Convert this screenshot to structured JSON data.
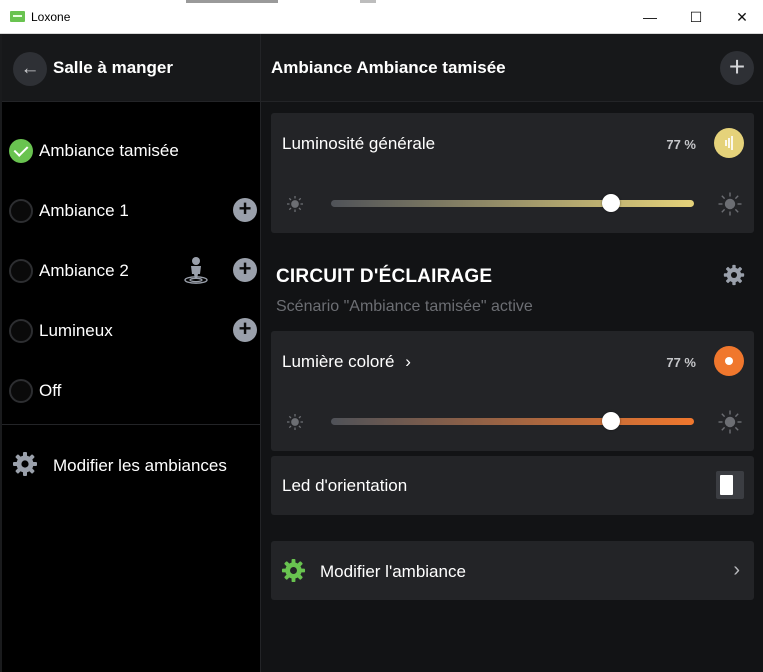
{
  "window": {
    "title": "Loxone",
    "minimize_glyph": "—",
    "maximize_glyph": "☐",
    "close_glyph": "✕"
  },
  "left": {
    "back_glyph": "←",
    "room_title": "Salle à manger",
    "scenes": [
      {
        "label": "Ambiance tamisée",
        "selected": true,
        "has_add": false,
        "has_presence": false
      },
      {
        "label": "Ambiance 1",
        "selected": false,
        "has_add": true,
        "has_presence": false
      },
      {
        "label": "Ambiance 2",
        "selected": false,
        "has_add": true,
        "has_presence": true
      },
      {
        "label": "Lumineux",
        "selected": false,
        "has_add": true,
        "has_presence": false
      },
      {
        "label": "Off",
        "selected": false,
        "has_add": false,
        "has_presence": false
      }
    ],
    "add_glyph": "+",
    "modify_all_label": "Modifier les ambiances"
  },
  "right": {
    "header_title": "Ambiance Ambiance tamisée",
    "plus_glyph": "+",
    "master": {
      "label": "Luminosité générale",
      "value_text": "77 %",
      "value": 77,
      "color": "#e5d27a"
    },
    "section": {
      "title": "CIRCUIT D'ÉCLAIRAGE",
      "subtitle": "Scénario \"Ambiance tamisée\" active"
    },
    "colored": {
      "label": "Lumière coloré",
      "chevron": "›",
      "value_text": "77 %",
      "value": 77,
      "color": "#f0772d"
    },
    "led": {
      "label": "Led d'orientation",
      "on": false
    },
    "modify": {
      "label": "Modifier l'ambiance",
      "chevron": "›"
    }
  },
  "colors": {
    "accent_green": "#69c350",
    "card_bg": "#232427",
    "panel_bg": "#121315"
  }
}
